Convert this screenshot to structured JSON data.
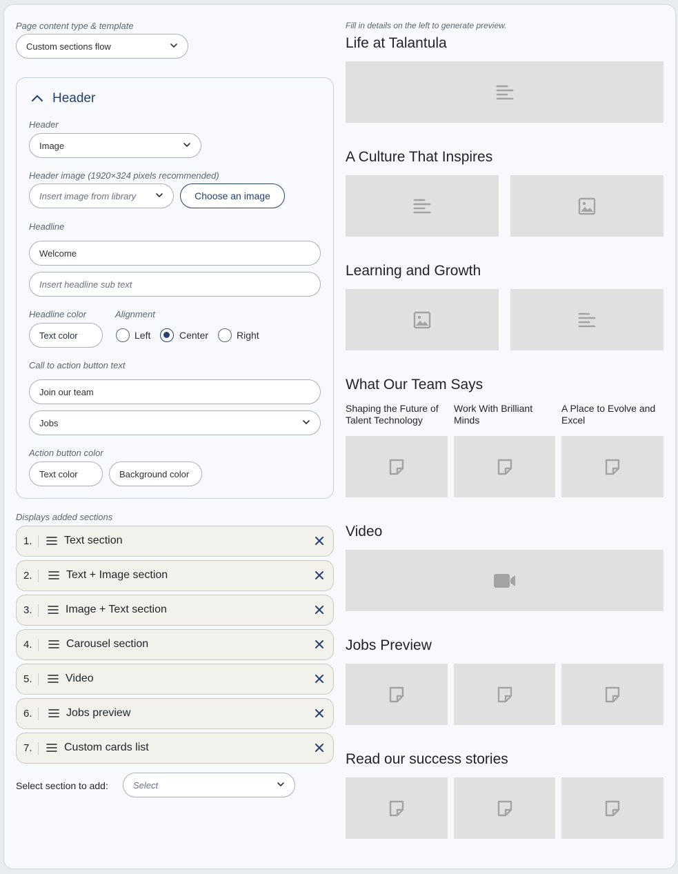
{
  "left": {
    "template_label": "Page content type & template",
    "template_value": "Custom sections flow",
    "header_card": {
      "title": "Header",
      "header_label": "Header",
      "header_value": "Image",
      "image_label": "Header image (1920×324 pixels recommended)",
      "image_select_placeholder": "Insert image from library",
      "choose_image_button": "Choose an image",
      "headline_label": "Headline",
      "headline_value": "Welcome",
      "subtext_placeholder": "Insert headline sub text",
      "headline_color_label": "Headline color",
      "headline_color_button": "Text color",
      "alignment_label": "Alignment",
      "alignment_options": [
        "Left",
        "Center",
        "Right"
      ],
      "alignment_selected": "Center",
      "cta_label": "Call to action button text",
      "cta_value": "Join our team",
      "cta_link_value": "Jobs",
      "action_color_label": "Action button color",
      "action_text_color_button": "Text color",
      "action_bg_color_button": "Background color"
    },
    "sections_label": "Displays added sections",
    "sections": [
      {
        "num": "1.",
        "title": "Text section"
      },
      {
        "num": "2.",
        "title": "Text + Image section"
      },
      {
        "num": "3.",
        "title": "Image + Text section"
      },
      {
        "num": "4.",
        "title": "Carousel section"
      },
      {
        "num": "5.",
        "title": "Video"
      },
      {
        "num": "6.",
        "title": "Jobs preview"
      },
      {
        "num": "7.",
        "title": "Custom cards list"
      }
    ],
    "add_section_label": "Select section to add:",
    "add_section_placeholder": "Select"
  },
  "preview": {
    "hint": "Fill in details on the left to generate preview.",
    "page_title": "Life at Talantula",
    "sections": [
      {
        "title": "A Culture That Inspires"
      },
      {
        "title": "Learning and Growth"
      },
      {
        "title": "What Our Team Says",
        "cards": [
          "Shaping the Future of Talent Technology",
          "Work With Brilliant Minds",
          "A Place to Evolve and Excel"
        ]
      },
      {
        "title": "Video"
      },
      {
        "title": "Jobs Preview"
      },
      {
        "title": "Read our success stories"
      }
    ]
  },
  "icons": {
    "text_placeholder": "text-lines-icon",
    "image_placeholder": "image-icon",
    "card_placeholder": "note-icon",
    "video_placeholder": "video-camera-icon",
    "remove": "close-icon",
    "drag": "drag-handle-icon",
    "collapse": "chevron-up-icon",
    "dropdown": "chevron-down-icon"
  },
  "colors": {
    "accent": "#27406f",
    "placeholder_bg": "#e0e0e0",
    "section_row_bg": "#f2f1ec"
  }
}
